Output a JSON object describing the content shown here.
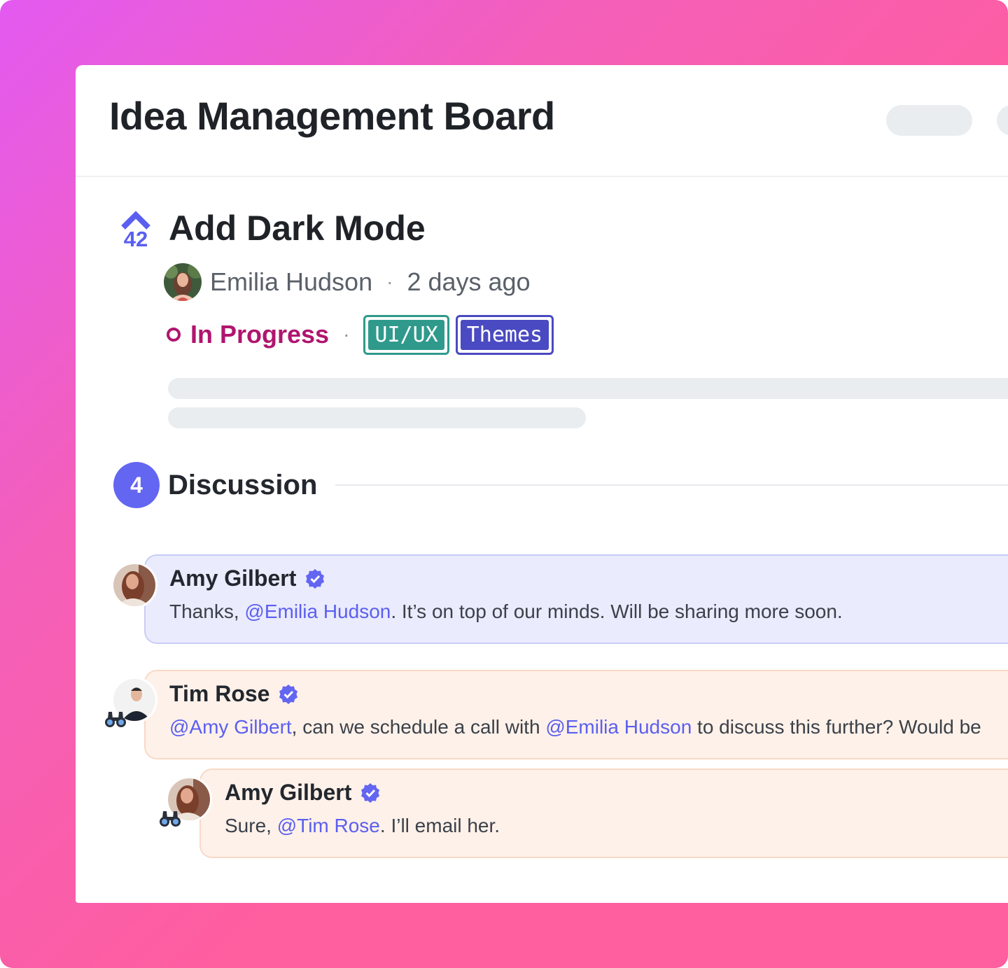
{
  "board": {
    "title": "Idea Management Board"
  },
  "idea": {
    "vote_count": "42",
    "title": "Add Dark Mode",
    "author": "Emilia Hudson",
    "separator": "·",
    "posted": "2 days ago",
    "status": "In Progress",
    "status_color": "#b0156f",
    "tags": [
      {
        "label": "UI/UX",
        "color": "#2f9a8c"
      },
      {
        "label": "Themes",
        "color": "#4a4ac2"
      }
    ]
  },
  "discussion": {
    "count": "4",
    "title": "Discussion",
    "accent": "#6366f1",
    "comments": [
      {
        "author": "Amy Gilbert",
        "verified_icon": "verified-badge-icon",
        "text_before": "Thanks, ",
        "mention_1": "@Emilia Hudson",
        "text_after": ". It’s on top of our minds. Will be sharing more soon."
      },
      {
        "author": "Tim Rose",
        "verified_icon": "verified-badge-icon",
        "mention_1": "@Amy Gilbert",
        "text_mid": ", can we schedule a call with ",
        "mention_2": "@Emilia Hudson",
        "text_after": " to discuss this further? Would be",
        "reaction_icon": "binoculars-icon"
      },
      {
        "author": "Amy Gilbert",
        "verified_icon": "verified-badge-icon",
        "text_before": "Sure, ",
        "mention_1": "@Tim Rose",
        "text_after": ". I’ll email her.",
        "reaction_icon": "binoculars-icon"
      }
    ]
  }
}
